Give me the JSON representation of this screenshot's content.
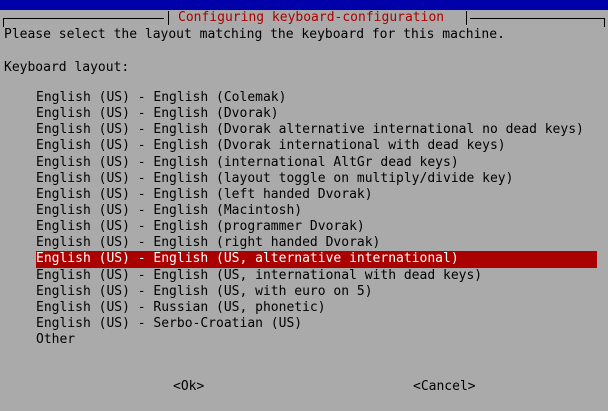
{
  "dialog": {
    "title": "Configuring keyboard-configuration",
    "description": "Please select the layout matching the keyboard for this machine.",
    "field_label": "Keyboard layout:",
    "layouts": [
      "English (US) - English (Colemak)",
      "English (US) - English (Dvorak)",
      "English (US) - English (Dvorak alternative international no dead keys)",
      "English (US) - English (Dvorak international with dead keys)",
      "English (US) - English (international AltGr dead keys)",
      "English (US) - English (layout toggle on multiply/divide key)",
      "English (US) - English (left handed Dvorak)",
      "English (US) - English (Macintosh)",
      "English (US) - English (programmer Dvorak)",
      "English (US) - English (right handed Dvorak)",
      "English (US) - English (US, alternative international)",
      "English (US) - English (US, international with dead keys)",
      "English (US) - English (US, with euro on 5)",
      "English (US) - Russian (US, phonetic)",
      "English (US) - Serbo-Croatian (US)",
      "Other"
    ],
    "selected_index": 10,
    "ok_label": "<Ok>",
    "cancel_label": "<Cancel>"
  },
  "colors": {
    "background": "#0000aa",
    "dialog": "#aaaaaa",
    "title": "#aa0000",
    "highlight": "#aa0000",
    "highlight_text": "#ffffff"
  }
}
